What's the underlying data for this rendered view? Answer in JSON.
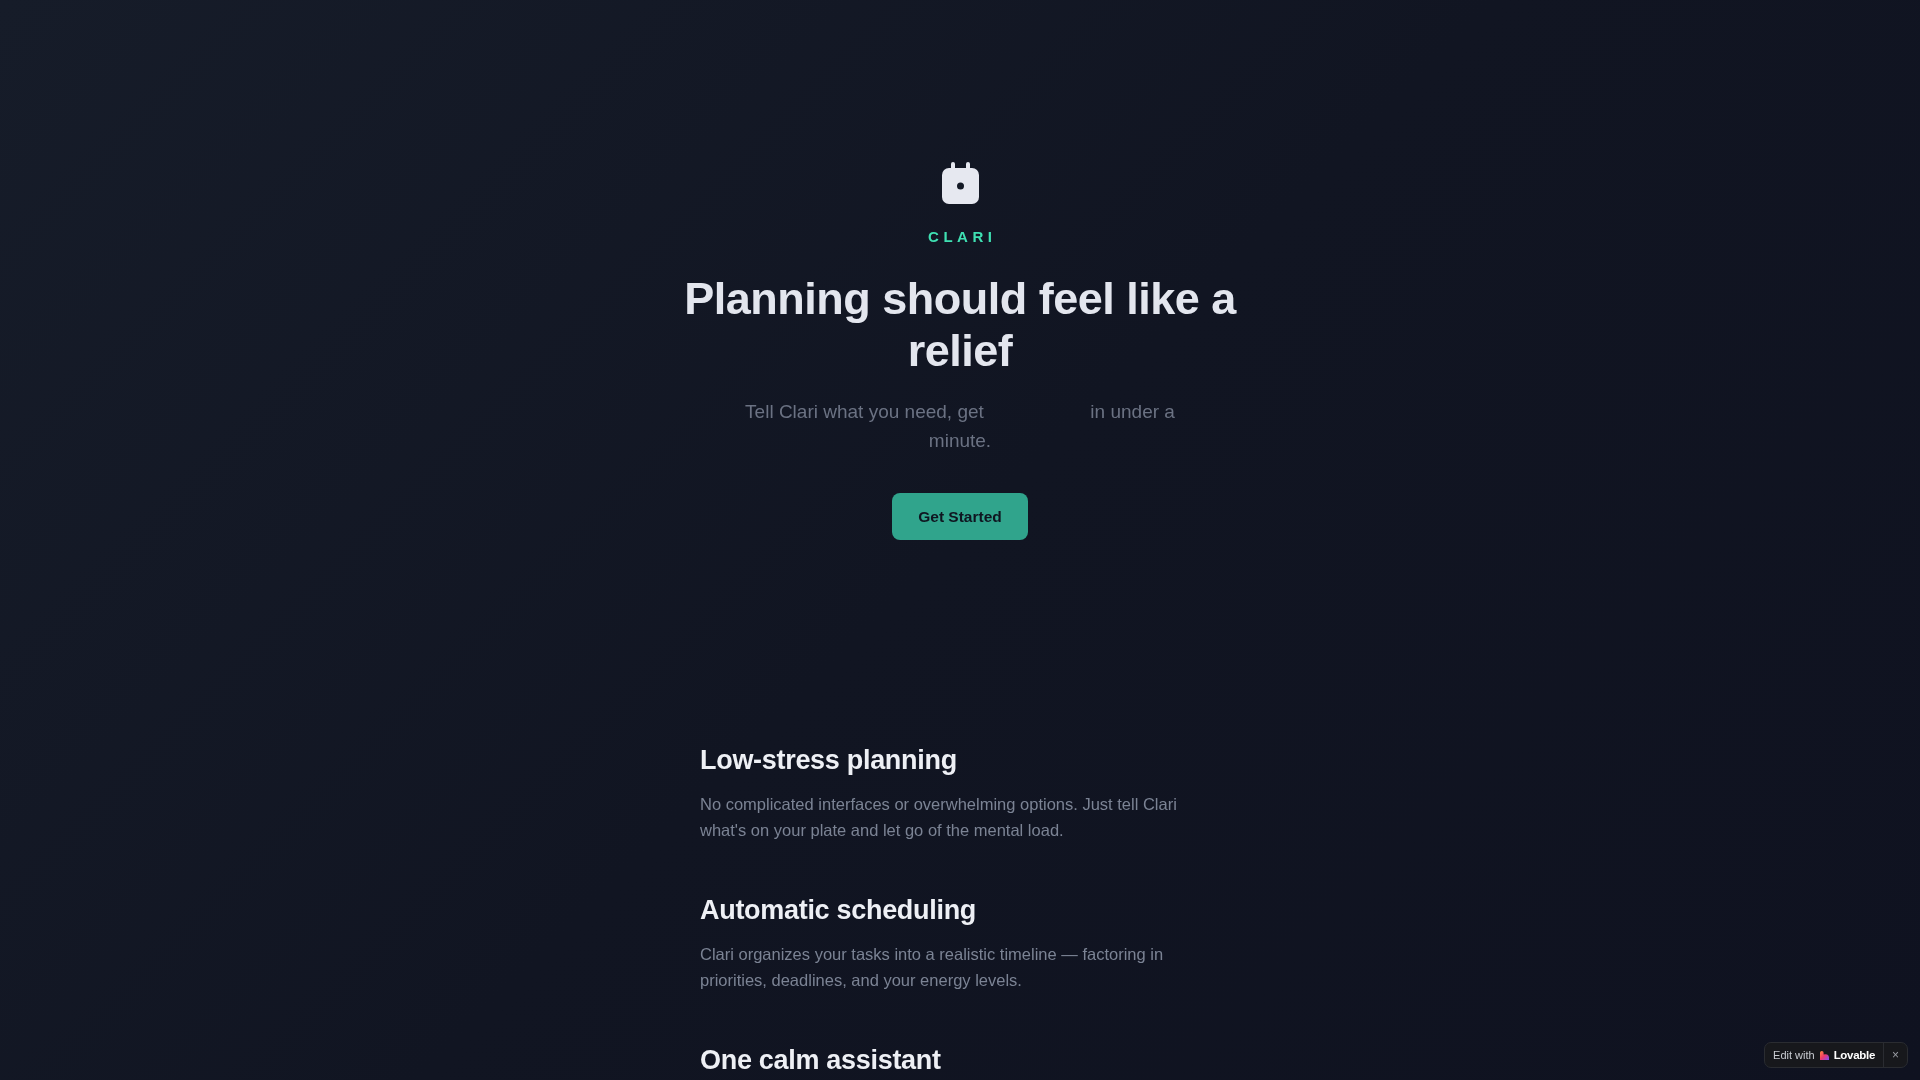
{
  "hero": {
    "brand": "CLARI",
    "headline": "Planning should feel like a relief",
    "subtitle_start": "Tell Clari what you need, get",
    "subtitle_end": "in under a minute.",
    "button": "Get Started"
  },
  "features": [
    {
      "title": "Low-stress planning",
      "text": "No complicated interfaces or overwhelming options. Just tell Clari what's on your plate and let go of the mental load."
    },
    {
      "title": "Automatic scheduling",
      "text": "Clari organizes your tasks into a realistic timeline — factoring in priorities, deadlines, and your energy levels."
    },
    {
      "title": "One calm assistant"
    }
  ],
  "badge": {
    "label": "Edit with",
    "brand": "Lovable",
    "close": "×"
  }
}
